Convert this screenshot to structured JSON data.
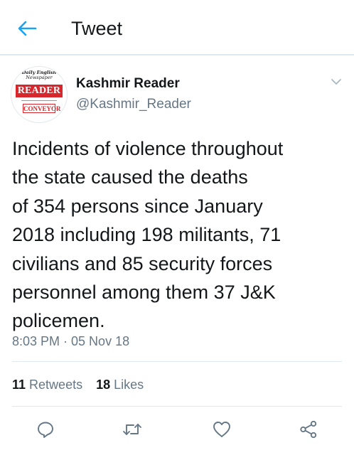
{
  "header": {
    "title": "Tweet",
    "back_icon": "arrow-left-icon"
  },
  "colors": {
    "accent": "#1da1f2",
    "text": "#14171a",
    "secondary": "#657786",
    "divider": "#e1e8ed",
    "brand_red": "#d7262c"
  },
  "author": {
    "avatar": {
      "tag_line_1": "Daily English",
      "tag_line_2": "Newspaper",
      "masthead": "READER",
      "sub_masthead": "CONVEYOR"
    },
    "display_name": "Kashmir Reader",
    "handle": "@Kashmir_Reader"
  },
  "tweet": {
    "lines": [
      "Incidents of violence throughout",
      "the state caused the deaths",
      "of 354 persons since January",
      "2018 including 198 militants, 71",
      "civilians and 85 security forces",
      "personnel among them 37 J&K",
      "policemen."
    ],
    "timestamp": "8:03 PM · 05 Nov 18"
  },
  "stats": {
    "retweets_count": "11",
    "retweets_label": "Retweets",
    "likes_count": "18",
    "likes_label": "Likes"
  },
  "actions": {
    "reply_icon": "reply-icon",
    "retweet_icon": "retweet-icon",
    "like_icon": "heart-icon",
    "share_icon": "share-icon"
  }
}
